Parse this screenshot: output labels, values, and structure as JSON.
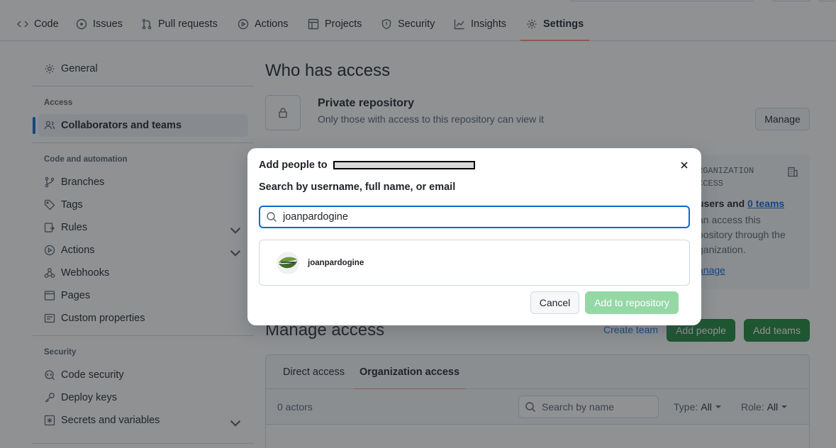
{
  "nav": {
    "tabs": [
      {
        "label": "Code",
        "icon": "code-icon"
      },
      {
        "label": "Issues",
        "icon": "issue-icon"
      },
      {
        "label": "Pull requests",
        "icon": "pull-request-icon"
      },
      {
        "label": "Actions",
        "icon": "play-icon"
      },
      {
        "label": "Projects",
        "icon": "table-icon"
      },
      {
        "label": "Security",
        "icon": "shield-icon"
      },
      {
        "label": "Insights",
        "icon": "graph-icon"
      },
      {
        "label": "Settings",
        "icon": "gear-icon",
        "active": true
      }
    ]
  },
  "sidebar": {
    "general": "General",
    "access_heading": "Access",
    "collaborators": "Collaborators and teams",
    "code_heading": "Code and automation",
    "items": [
      "Branches",
      "Tags",
      "Rules",
      "Actions",
      "Webhooks",
      "Pages",
      "Custom properties"
    ],
    "security_heading": "Security",
    "security_items": [
      "Code security",
      "Deploy keys",
      "Secrets and variables"
    ]
  },
  "access": {
    "title": "Who has access",
    "private_title": "Private repository",
    "private_sub": "Only those with access to this repository can view it",
    "manage_button": "Manage",
    "org_heading_1": "RGANIZATION",
    "org_heading_2": "CCESS",
    "org_users": "users and",
    "org_teams": "0 teams",
    "org_line1": "an access this",
    "org_line2": "pository through the",
    "org_line3": "ganization.",
    "org_manage": "anage"
  },
  "manage": {
    "title": "Manage access",
    "create_team": "Create team",
    "add_people": "Add people",
    "add_teams": "Add teams",
    "tabs": [
      "Direct access",
      "Organization access"
    ],
    "actors": "0 actors",
    "search_placeholder": "Search by name",
    "type_label": "Type:",
    "type_value": "All",
    "role_label": "Role:",
    "role_value": "All"
  },
  "dialog": {
    "title": "Add people to",
    "label": "Search by username, full name, or email",
    "search_value": "joanpardogine",
    "result_name": "joanpardogine",
    "cancel": "Cancel",
    "add": "Add to repository"
  },
  "colors": {
    "accent": "#0969da",
    "primary_green": "#1f883d",
    "disabled_green": "#95d8a6",
    "underline": "#fd8c73"
  }
}
